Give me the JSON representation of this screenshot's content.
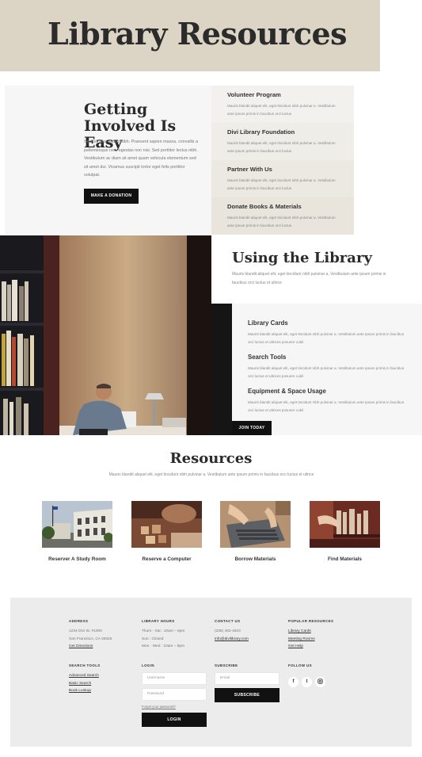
{
  "header": {
    "title": "Library Resources"
  },
  "involved": {
    "heading": "Getting Involved Is Easy",
    "body": "Sed porttitor lectus nibh. Praesent sapien massa, convallis a pellentesque nec, egestas non nisi. Sed porttitor lectus nibh. Vestibulum ac diam sit amet quam vehicula elementum sed sit amet dui. Vivamus suscipit tortor eget felis porttitor volutpat.",
    "button": "Make a Donation"
  },
  "programs": [
    {
      "title": "Volunteer Program",
      "text": "Mauris blandit aliquet elit, eget tincidunt nibh pulvinar a. Vestibulum ante ipsum primis in faucibus orci luctus",
      "bg": "#f2f1ee"
    },
    {
      "title": "Divi Library Foundation",
      "text": "Mauris blandit aliquet elit, eget tincidunt nibh pulvinar a. Vestibulum ante ipsum primis in faucibus orci luctus",
      "bg": "#efede8"
    },
    {
      "title": "Partner With Us",
      "text": "Mauris blandit aliquet elit, eget tincidunt nibh pulvinar a. Vestibulum ante ipsum primis in faucibus orci luctus",
      "bg": "#ece9e2"
    },
    {
      "title": "Donate Books & Materials",
      "text": "Mauris blandit aliquet elit, eget tincidunt nibh pulvinar a. Vestibulum ante ipsum primis in faucibus orci luctus",
      "bg": "#e9e5dc"
    }
  ],
  "using": {
    "heading": "Using the Library",
    "text": "Mauris blandit aliquet elit, eget tincidunt nibh pulvinar a. Vestibulum ante ipsum primis in faucibus orci luctus et ultrice",
    "items": [
      {
        "title": "Library Cards",
        "text": "Mauris blandit aliquet elit, eget tincidunt nibh pulvinar a. Vestibulum ante ipsum primis in faucibus orci luctus et ultrices posuere cubil"
      },
      {
        "title": "Search Tools",
        "text": "Mauris blandit aliquet elit, eget tincidunt nibh pulvinar a. Vestibulum ante ipsum primis in faucibus orci luctus et ultrices posuere cubil"
      },
      {
        "title": "Equipment & Space Usage",
        "text": "Mauris blandit aliquet elit, eget tincidunt nibh pulvinar a. Vestibulum ante ipsum primis in faucibus orci luctus et ultrices posuere cubil"
      }
    ],
    "button": "Join Today"
  },
  "resources": {
    "heading": "Resources",
    "text": "Mauris blandit aliquet elit, eget tincidunt nibh pulvinar a. Vestibulum ante ipsum primis in faucibus orci luctus et ultrice",
    "cards": [
      {
        "label": "Reserver A Study Room"
      },
      {
        "label": "Reserve a Computer"
      },
      {
        "label": "Borrow Materials"
      },
      {
        "label": "Find Materials"
      }
    ]
  },
  "footer": {
    "address": {
      "heading": "Address",
      "lines": [
        "1234 Divi St. #1000",
        "San Francisco, CA 39325"
      ],
      "link": "Get Directions"
    },
    "hours": {
      "heading": "Library Hours",
      "lines": [
        "Thurs - Sat : 10am – 6pm",
        "Sun : Closed",
        "Mon - Wed : 10am – 8pm"
      ]
    },
    "contact": {
      "heading": "Contact Us",
      "phone": "(235) 462-4623",
      "email": "info@divilibrary.com"
    },
    "popular": {
      "heading": "Popular Resources",
      "links": [
        "Library Cards",
        "Meeting Rooms",
        "Get Help"
      ]
    },
    "search_tools": {
      "heading": "Search Tools",
      "links": [
        "Advanced Search",
        "Basic Search",
        "Book Lookup"
      ]
    },
    "login": {
      "heading": "Login",
      "username_placeholder": "Username",
      "password_placeholder": "Password",
      "forgot": "Forgot your password?",
      "button": "Login"
    },
    "subscribe": {
      "heading": "Subscribe",
      "email_placeholder": "Email",
      "button": "Subscribe"
    },
    "follow": {
      "heading": "Follow Us",
      "icons": [
        "facebook-icon",
        "twitter-icon",
        "instagram-icon"
      ]
    }
  }
}
